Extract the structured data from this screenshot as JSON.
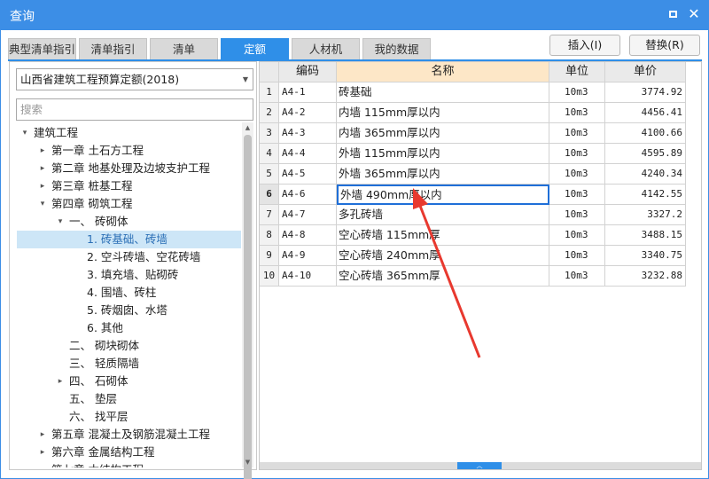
{
  "window": {
    "title": "查询",
    "maximize_icon": "maximize-icon",
    "close_icon": "close-icon"
  },
  "tabs": [
    {
      "label": "典型清单指引",
      "active": false
    },
    {
      "label": "清单指引",
      "active": false
    },
    {
      "label": "清单",
      "active": false
    },
    {
      "label": "定额",
      "active": true
    },
    {
      "label": "人材机",
      "active": false
    },
    {
      "label": "我的数据",
      "active": false
    }
  ],
  "buttons": {
    "insert": "插入(I)",
    "replace": "替换(R)"
  },
  "left": {
    "library_select": "山西省建筑工程预算定额(2018)",
    "search_placeholder": "搜索",
    "tree": [
      {
        "label": "建筑工程",
        "toggle": "▾",
        "level": 0
      },
      {
        "label": "第一章 土石方工程",
        "toggle": "▸",
        "level": 1
      },
      {
        "label": "第二章 地基处理及边坡支护工程",
        "toggle": "▸",
        "level": 1
      },
      {
        "label": "第三章 桩基工程",
        "toggle": "▸",
        "level": 1
      },
      {
        "label": "第四章 砌筑工程",
        "toggle": "▾",
        "level": 1
      },
      {
        "label": "一、 砖砌体",
        "toggle": "▾",
        "level": 2
      },
      {
        "label": "1. 砖基础、砖墙",
        "toggle": "",
        "level": 3,
        "selected": true
      },
      {
        "label": "2. 空斗砖墙、空花砖墙",
        "toggle": "",
        "level": 3
      },
      {
        "label": "3. 填充墙、贴砌砖",
        "toggle": "",
        "level": 3
      },
      {
        "label": "4. 围墙、砖柱",
        "toggle": "",
        "level": 3
      },
      {
        "label": "5. 砖烟囱、水塔",
        "toggle": "",
        "level": 3
      },
      {
        "label": "6. 其他",
        "toggle": "",
        "level": 3
      },
      {
        "label": "二、 砌块砌体",
        "toggle": "",
        "level": 2
      },
      {
        "label": "三、 轻质隔墙",
        "toggle": "",
        "level": 2
      },
      {
        "label": "四、 石砌体",
        "toggle": "▸",
        "level": 2
      },
      {
        "label": "五、 垫层",
        "toggle": "",
        "level": 2
      },
      {
        "label": "六、 找平层",
        "toggle": "",
        "level": 2
      },
      {
        "label": "第五章 混凝土及钢筋混凝土工程",
        "toggle": "▸",
        "level": 1
      },
      {
        "label": "第六章 金属结构工程",
        "toggle": "▸",
        "level": 1
      },
      {
        "label": "第七章 木结构工程",
        "toggle": "▸",
        "level": 1
      }
    ]
  },
  "table": {
    "headers": {
      "code": "编码",
      "name": "名称",
      "unit": "单位",
      "price": "单价"
    },
    "rows": [
      {
        "n": "1",
        "code": "A4-1",
        "name": "砖基础",
        "unit": "10m3",
        "price": "3774.92"
      },
      {
        "n": "2",
        "code": "A4-2",
        "name": "内墙 115mm厚以内",
        "unit": "10m3",
        "price": "4456.41"
      },
      {
        "n": "3",
        "code": "A4-3",
        "name": "内墙 365mm厚以内",
        "unit": "10m3",
        "price": "4100.66"
      },
      {
        "n": "4",
        "code": "A4-4",
        "name": "外墙 115mm厚以内",
        "unit": "10m3",
        "price": "4595.89"
      },
      {
        "n": "5",
        "code": "A4-5",
        "name": "外墙 365mm厚以内",
        "unit": "10m3",
        "price": "4240.34"
      },
      {
        "n": "6",
        "code": "A4-6",
        "name": "外墙 490mm厚以内",
        "unit": "10m3",
        "price": "4142.55",
        "current": true
      },
      {
        "n": "7",
        "code": "A4-7",
        "name": "多孔砖墙",
        "unit": "10m3",
        "price": "3327.2"
      },
      {
        "n": "8",
        "code": "A4-8",
        "name": "空心砖墙 115mm厚",
        "unit": "10m3",
        "price": "3488.15"
      },
      {
        "n": "9",
        "code": "A4-9",
        "name": "空心砖墙 240mm厚",
        "unit": "10m3",
        "price": "3340.75"
      },
      {
        "n": "10",
        "code": "A4-10",
        "name": "空心砖墙 365mm厚",
        "unit": "10m3",
        "price": "3232.88"
      }
    ]
  },
  "colors": {
    "accent": "#3c8ee6",
    "selection": "#cde6f7",
    "header_highlight": "#fde7c7",
    "annotation": "#e8392f"
  }
}
